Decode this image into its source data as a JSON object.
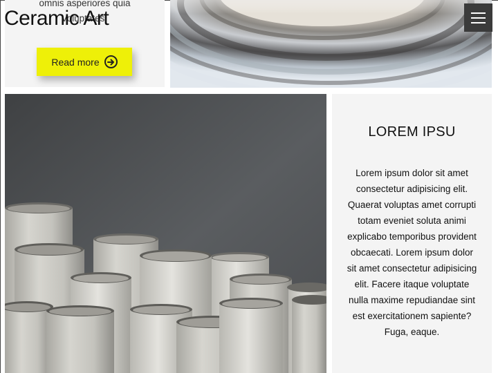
{
  "site": {
    "title": "Ceramic Art"
  },
  "top_card": {
    "text": "omnis asperiores quia voluptates.",
    "read_more_label": "Read more"
  },
  "menu": {
    "icon": "hamburger-menu-icon"
  },
  "feature_card": {
    "heading": "LOREM IPSU",
    "body": "Lorem ipsum dolor sit amet consectetur adipisicing elit. Quaerat voluptas amet corrupti totam eveniet soluta animi explicabo temporibus provident obcaecati. Lorem ipsum dolor sit amet consectetur adipisicing elit. Facere itaque voluptate nulla maxime repudiandae sint est exercitationem sapiente? Fuga, eaque."
  },
  "images": {
    "top": "ceramic-bowl-closeup-image",
    "main": "ceramic-cups-image"
  },
  "colors": {
    "accent": "#eef008",
    "card_bg": "#f4f4f4",
    "menu_bg": "#3b3b3b"
  }
}
